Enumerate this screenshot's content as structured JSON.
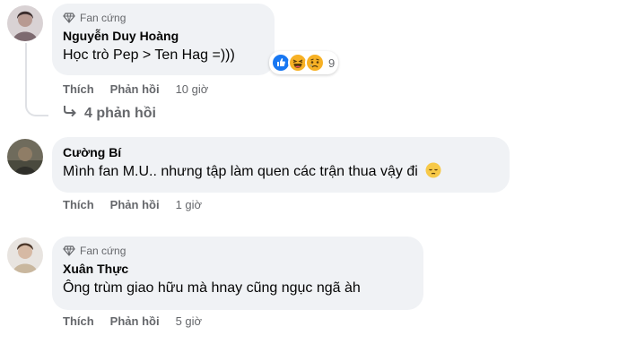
{
  "comments": [
    {
      "badge": "Fan cứng",
      "author": "Nguyễn Duy Hoàng",
      "text": "Học trò Pep > Ten Hag =)))",
      "reactions": {
        "icons": [
          "like-icon",
          "haha-icon",
          "sad-icon"
        ],
        "count": "9"
      },
      "like_label": "Thích",
      "reply_label": "Phản hồi",
      "time": "10 giờ",
      "replies_label": "4 phản hồi"
    },
    {
      "author": "Cường Bí",
      "text": "Mình fan M.U.. nhưng tập làm quen các trận thua vậy đi",
      "emoji": "pensive-face-icon",
      "like_label": "Thích",
      "reply_label": "Phản hồi",
      "time": "1 giờ"
    },
    {
      "badge": "Fan cứng",
      "author": "Xuân Thực",
      "text": "Ông trùm giao hữu mà hnay cũng ngục ngã àh",
      "like_label": "Thích",
      "reply_label": "Phản hồi",
      "time": "5 giờ"
    }
  ],
  "colors": {
    "bubble": "#f0f2f5",
    "secondary_text": "#65676b",
    "like_blue": "#1877f2",
    "reaction_yellow": "#f7b125"
  }
}
